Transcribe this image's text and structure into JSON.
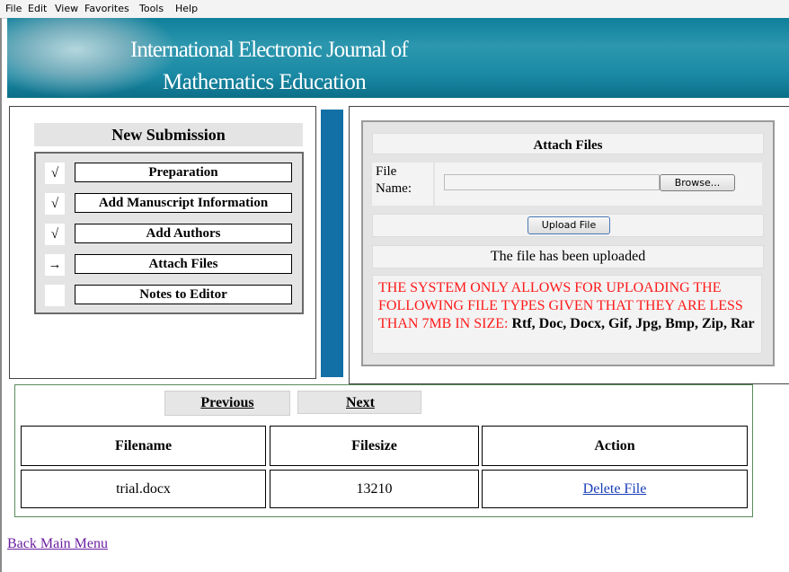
{
  "menubar": {
    "items": [
      "File",
      "Edit",
      "View",
      "Favorites",
      "Tools",
      "Help"
    ]
  },
  "banner": {
    "line1": "International Electronic Journal of",
    "line2": "Mathematics Education"
  },
  "submission": {
    "title": "New Submission",
    "steps": [
      {
        "mark": "√",
        "label": "Preparation"
      },
      {
        "mark": "√",
        "label": "Add Manuscript Information"
      },
      {
        "mark": "√",
        "label": "Add Authors"
      },
      {
        "mark": "→",
        "label": "Attach Files"
      },
      {
        "mark": "",
        "label": "Notes to Editor"
      }
    ]
  },
  "attach": {
    "title": "Attach Files",
    "file_label": "File Name:",
    "file_value": "",
    "browse_label": "Browse...",
    "upload_label": "Upload File",
    "status": "The file has been uploaded",
    "warning_red": "THE SYSTEM ONLY ALLOWS FOR UPLOADING THE FOLLOWING FILE TYPES GIVEN THAT THEY ARE LESS THAN 7MB IN SIZE: ",
    "warning_types": "Rtf, Doc, Docx, Gif, Jpg, Bmp, Zip, Rar"
  },
  "nav": {
    "previous": "Previous",
    "next": "Next"
  },
  "files_table": {
    "headers": [
      "Filename",
      "Filesize",
      "Action"
    ],
    "rows": [
      {
        "filename": "trial.docx",
        "filesize": "13210",
        "action": "Delete File"
      }
    ]
  },
  "footer": {
    "back_link": "Back Main Menu"
  },
  "colors": {
    "banner": "#1b8aa5",
    "divider_bar": "#1270a7",
    "warning": "#ff1a1a",
    "link": "#1a3fb8",
    "visited_link": "#6b1fa0"
  }
}
